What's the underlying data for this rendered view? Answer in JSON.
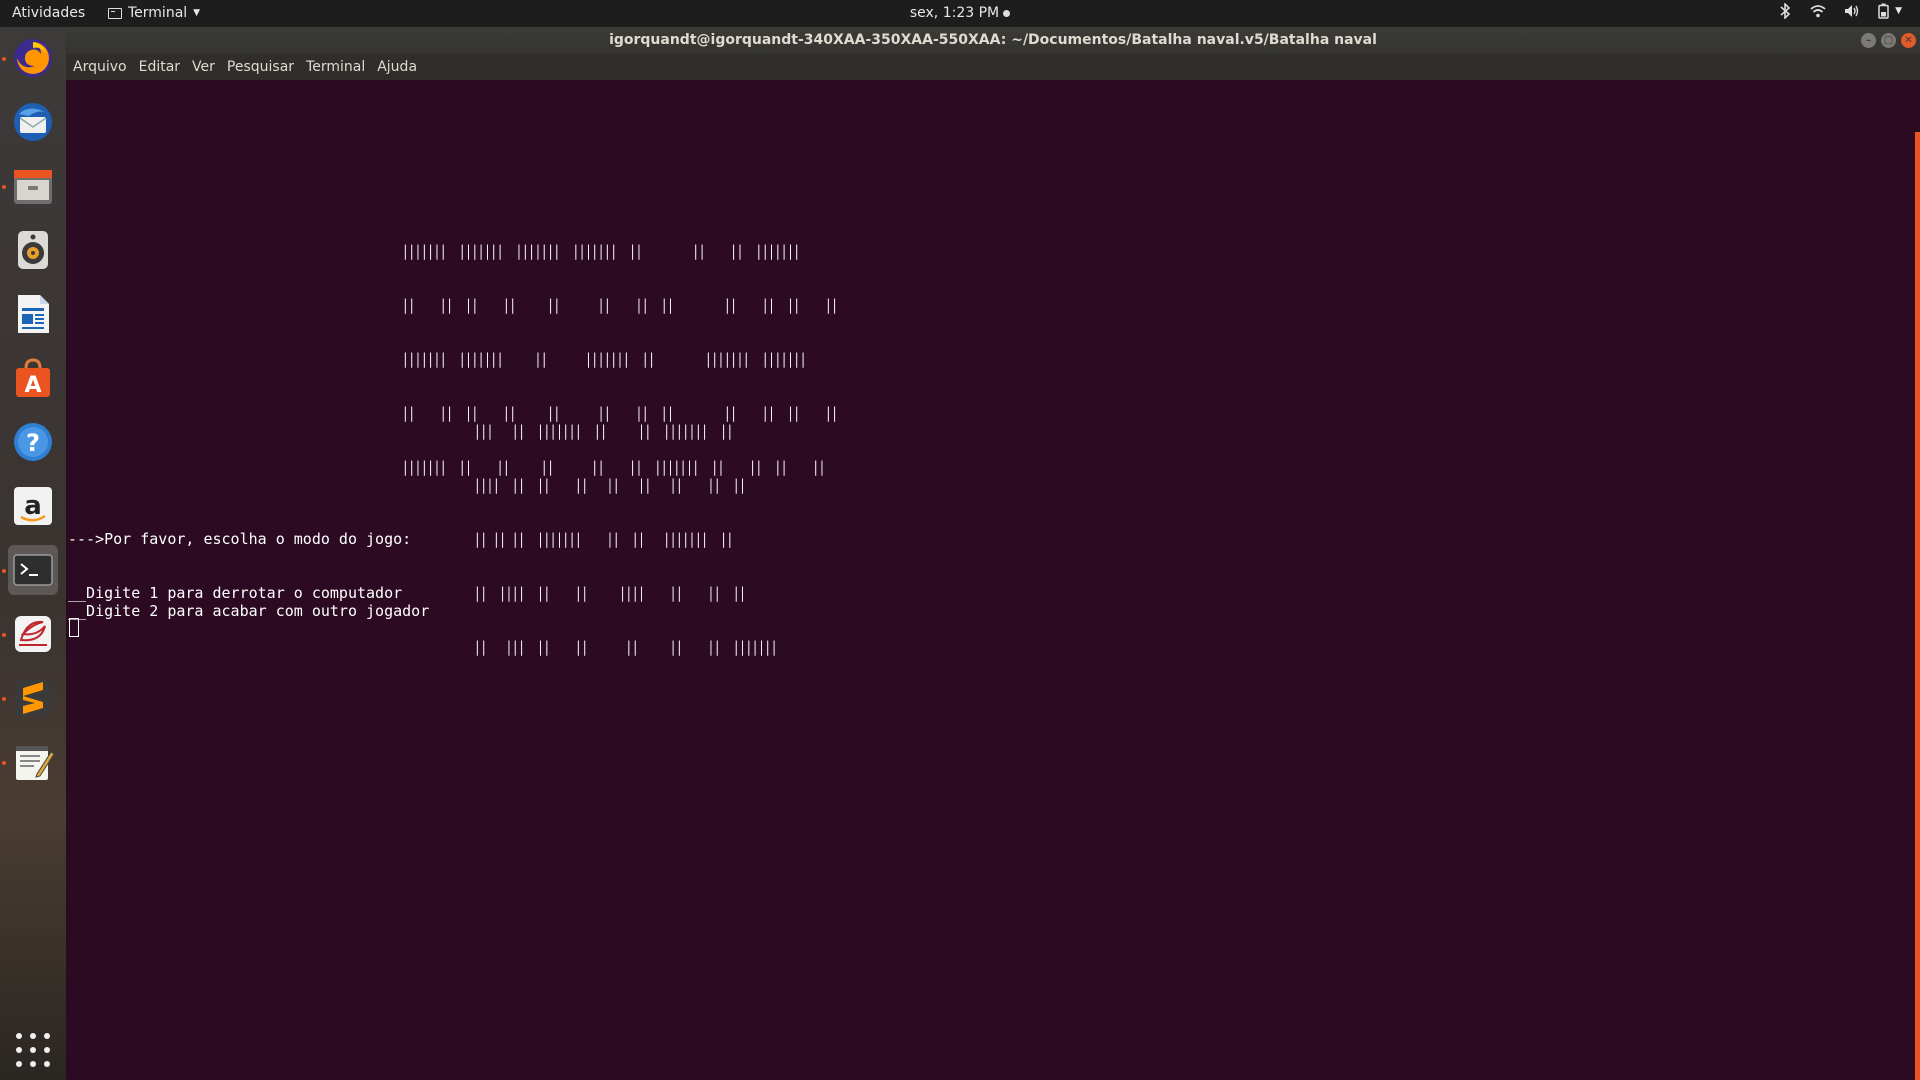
{
  "top_panel": {
    "activities": "Atividades",
    "app_menu": "Terminal",
    "clock": "sex,  1:23 PM"
  },
  "window": {
    "title": "igorquandt@igorquandt-340XAA-350XAA-550XAA: ~/Documentos/Batalha naval.v5/Batalha naval"
  },
  "menubar": {
    "items": [
      "Arquivo",
      "Editar",
      "Ver",
      "Pesquisar",
      "Terminal",
      "Ajuda"
    ]
  },
  "dock": {
    "items": [
      {
        "icon": "firefox-icon",
        "running": true
      },
      {
        "icon": "thunderbird-icon",
        "running": false
      },
      {
        "icon": "files-icon",
        "running": true
      },
      {
        "icon": "rhythmbox-icon",
        "running": false
      },
      {
        "icon": "libreoffice-writer-icon",
        "running": false
      },
      {
        "icon": "software-center-icon",
        "running": false
      },
      {
        "icon": "help-icon",
        "running": false
      },
      {
        "icon": "amazon-icon",
        "running": false
      },
      {
        "icon": "terminal-icon",
        "running": true,
        "active": true
      },
      {
        "icon": "evince-icon",
        "running": true
      },
      {
        "icon": "sublime-text-icon",
        "running": true
      },
      {
        "icon": "text-editor-icon",
        "running": true
      }
    ]
  },
  "terminal": {
    "banner_batalha": [
      "|||||||  |||||||  |||||||  |||||||  ||        ||    ||  |||||||",
      "||    ||  ||    ||     ||      ||    ||  ||        ||    ||  ||    ||",
      "|||||||  |||||||     ||      |||||||  ||        |||||||  |||||||",
      "||    ||  ||    ||     ||      ||    ||  ||        ||    ||  ||    ||",
      "|||||||  ||    ||     ||      ||    ||  |||||||  ||    ||  ||    ||"
    ],
    "banner_naval": [
      "|||   ||  |||||||  ||     ||  |||||||  ||",
      "||||  ||  ||    ||   ||   ||   ||    ||  ||",
      "|| || ||  |||||||    ||  ||   |||||||  ||",
      "||  ||||  ||    ||     ||||    ||    ||  ||",
      "||   |||  ||    ||      ||     ||    ||  |||||||"
    ],
    "prompt": "--->Por favor, escolha o modo do jogo:",
    "option_1": "__Digite 1 para derrotar o computador",
    "option_2": "__Digite 2 para acabar com outro jogador"
  },
  "colors": {
    "terminal_bg": "#2c0a22",
    "accent": "#e95420"
  }
}
